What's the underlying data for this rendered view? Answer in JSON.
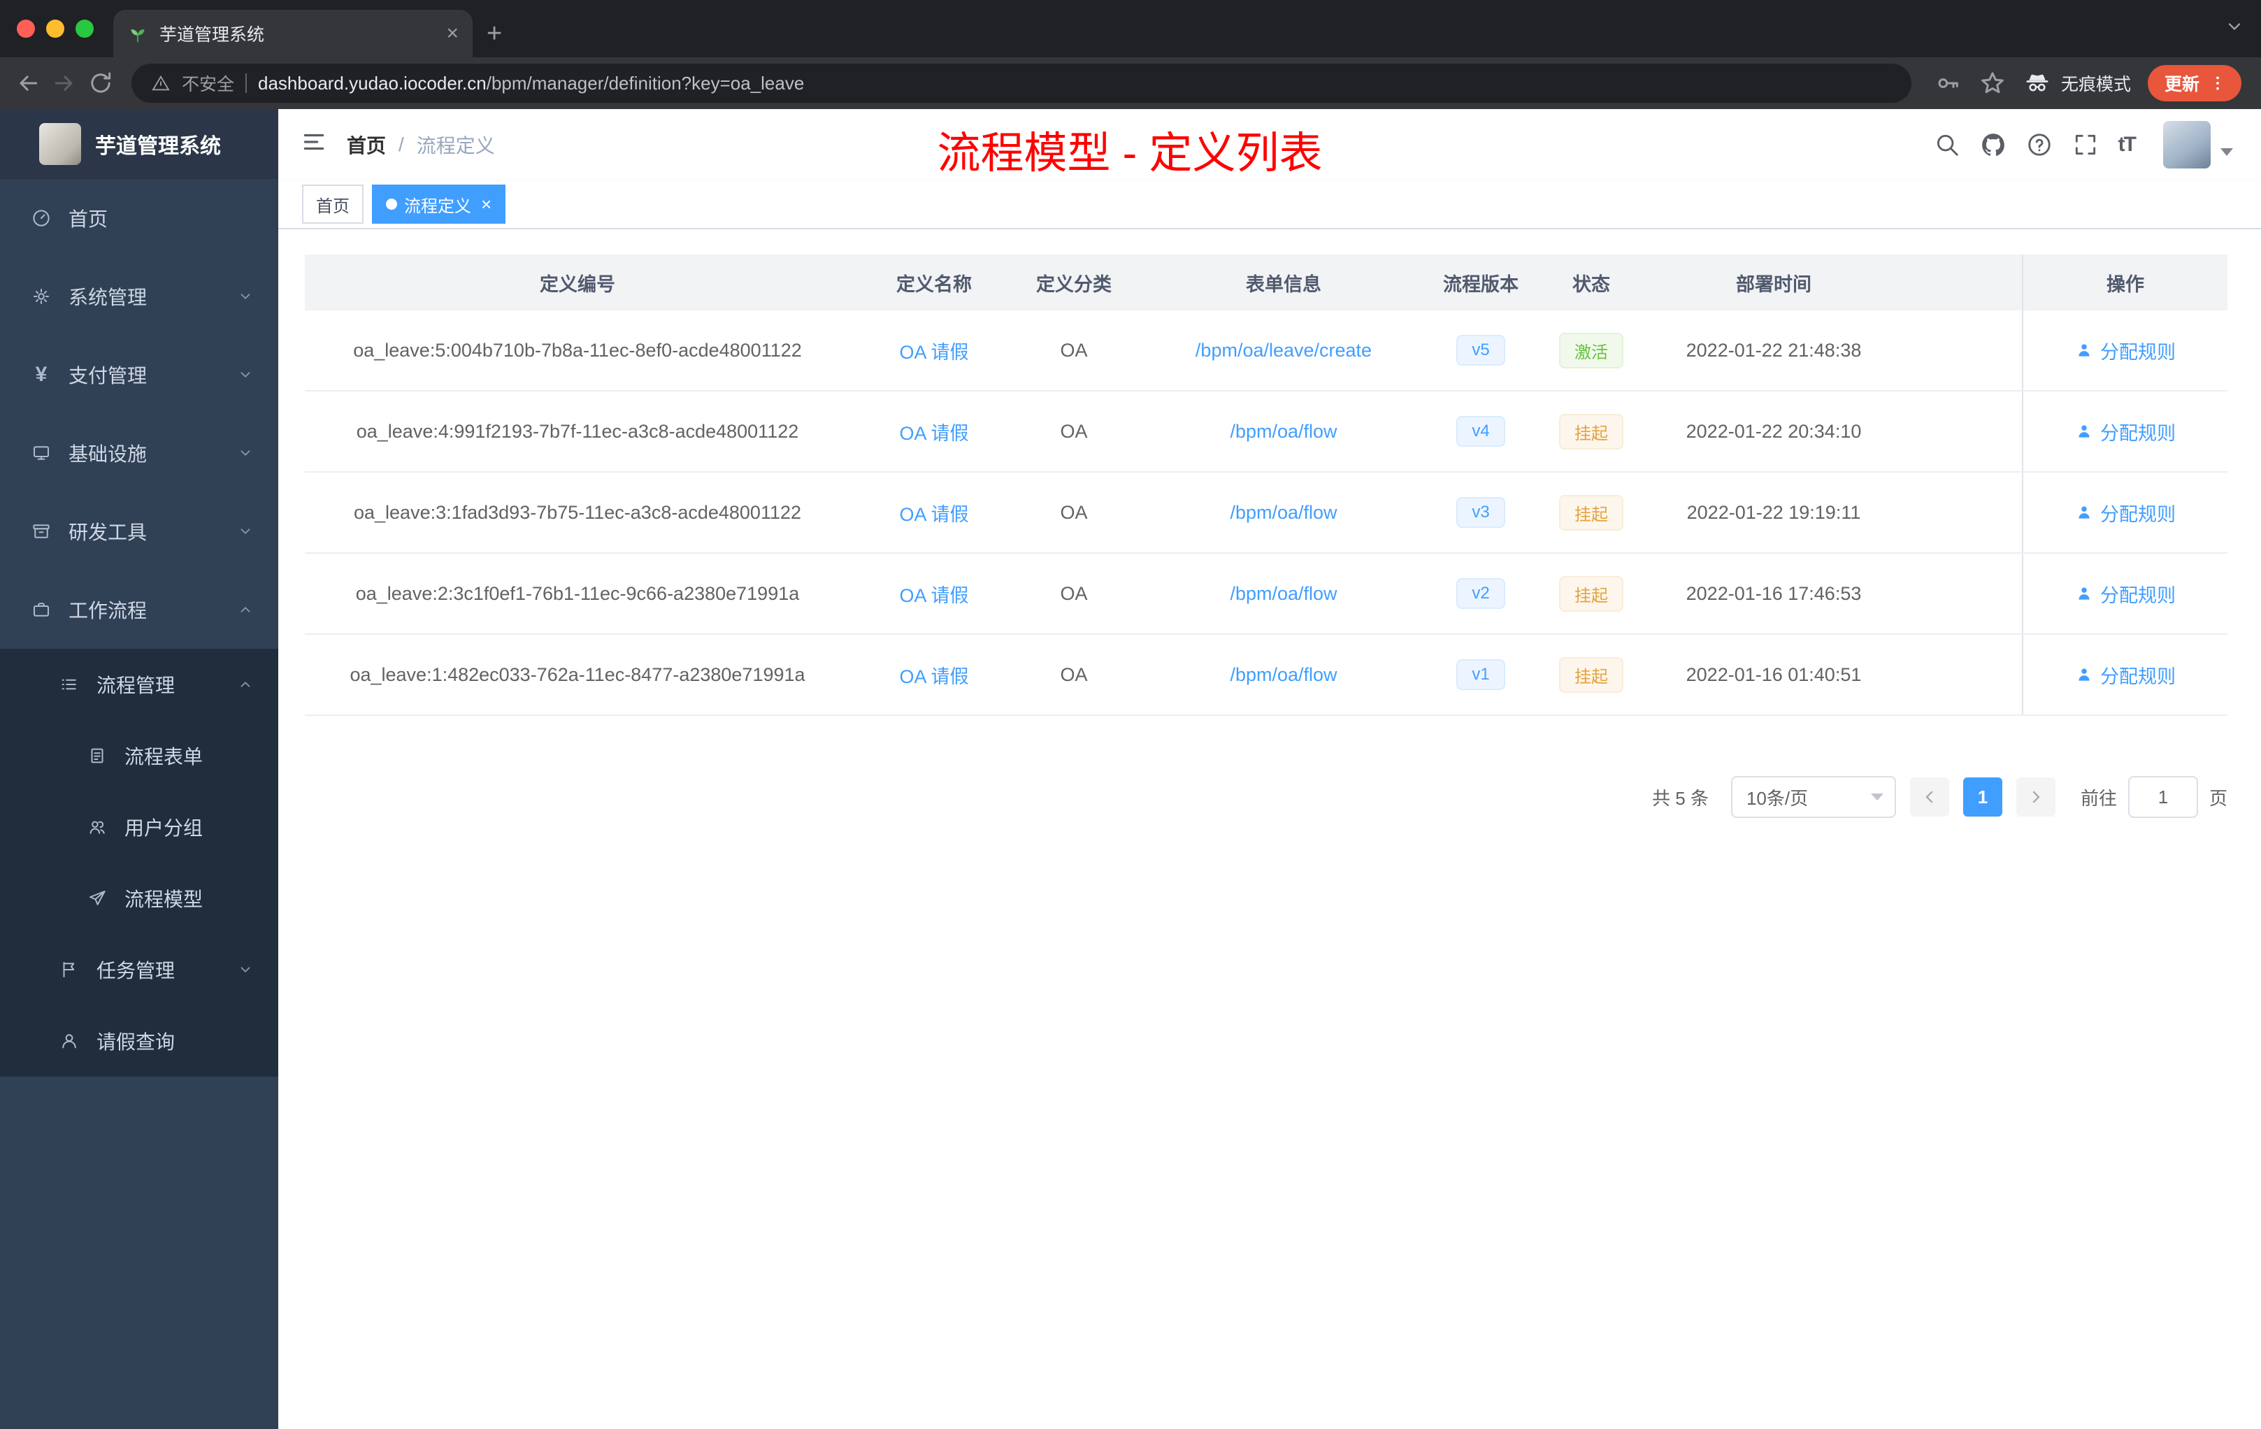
{
  "browser": {
    "tab_title": "芋道管理系统",
    "security_label": "不安全",
    "url_host": "dashboard.yudao.iocoder.cn",
    "url_path": "/bpm/manager/definition?key=oa_leave",
    "incognito_label": "无痕模式",
    "update_label": "更新"
  },
  "sidebar": {
    "logo_title": "芋道管理系统",
    "menu": [
      {
        "label": "首页",
        "icon": "dashboard-icon",
        "chevron": null
      },
      {
        "label": "系统管理",
        "icon": "gear-icon",
        "chevron": "down"
      },
      {
        "label": "支付管理",
        "icon": "yen-icon",
        "chevron": "down"
      },
      {
        "label": "基础设施",
        "icon": "monitor-icon",
        "chevron": "down"
      },
      {
        "label": "研发工具",
        "icon": "archive-icon",
        "chevron": "down"
      },
      {
        "label": "工作流程",
        "icon": "briefcase-icon",
        "chevron": "up"
      },
      {
        "label": "流程管理",
        "icon": "list-icon",
        "chevron": "up"
      },
      {
        "label": "流程表单",
        "icon": "form-icon",
        "chevron": null
      },
      {
        "label": "用户分组",
        "icon": "users-icon",
        "chevron": null
      },
      {
        "label": "流程模型",
        "icon": "send-icon",
        "chevron": null
      },
      {
        "label": "任务管理",
        "icon": "flag-icon",
        "chevron": "down"
      },
      {
        "label": "请假查询",
        "icon": "person-icon",
        "chevron": null
      }
    ]
  },
  "header": {
    "breadcrumb_home": "首页",
    "breadcrumb_sep": "/",
    "breadcrumb_current": "流程定义",
    "annotation_title": "流程模型 - 定义列表",
    "font_tool_label": "tT"
  },
  "tags": [
    {
      "label": "首页",
      "active": false
    },
    {
      "label": "流程定义",
      "active": true,
      "close": "×"
    }
  ],
  "table": {
    "columns": [
      "定义编号",
      "定义名称",
      "定义分类",
      "表单信息",
      "流程版本",
      "状态",
      "部署时间",
      "操作"
    ],
    "rows": [
      {
        "id": "oa_leave:5:004b710b-7b8a-11ec-8ef0-acde48001122",
        "name": "OA 请假",
        "category": "OA",
        "form": "/bpm/oa/leave/create",
        "version": "v5",
        "status": "激活",
        "status_type": "success",
        "deploy_time": "2022-01-22 21:48:38",
        "action": "分配规则"
      },
      {
        "id": "oa_leave:4:991f2193-7b7f-11ec-a3c8-acde48001122",
        "name": "OA 请假",
        "category": "OA",
        "form": "/bpm/oa/flow",
        "version": "v4",
        "status": "挂起",
        "status_type": "warning",
        "deploy_time": "2022-01-22 20:34:10",
        "action": "分配规则"
      },
      {
        "id": "oa_leave:3:1fad3d93-7b75-11ec-a3c8-acde48001122",
        "name": "OA 请假",
        "category": "OA",
        "form": "/bpm/oa/flow",
        "version": "v3",
        "status": "挂起",
        "status_type": "warning",
        "deploy_time": "2022-01-22 19:19:11",
        "action": "分配规则"
      },
      {
        "id": "oa_leave:2:3c1f0ef1-76b1-11ec-9c66-a2380e71991a",
        "name": "OA 请假",
        "category": "OA",
        "form": "/bpm/oa/flow",
        "version": "v2",
        "status": "挂起",
        "status_type": "warning",
        "deploy_time": "2022-01-16 17:46:53",
        "action": "分配规则"
      },
      {
        "id": "oa_leave:1:482ec033-762a-11ec-8477-a2380e71991a",
        "name": "OA 请假",
        "category": "OA",
        "form": "/bpm/oa/flow",
        "version": "v1",
        "status": "挂起",
        "status_type": "warning",
        "deploy_time": "2022-01-16 01:40:51",
        "action": "分配规则"
      }
    ]
  },
  "pagination": {
    "total_label": "共 5 条",
    "page_size_label": "10条/页",
    "current_page": "1",
    "goto_label": "前往",
    "goto_value": "1",
    "page_unit_label": "页"
  },
  "colors": {
    "accent": "#409eff",
    "success": "#67c23a",
    "warning": "#e6a23c",
    "annotation_red": "#ff0000",
    "sidebar_bg": "#304156",
    "submenu_bg": "#1f2d3d",
    "update_button_bg": "#e8563c"
  }
}
